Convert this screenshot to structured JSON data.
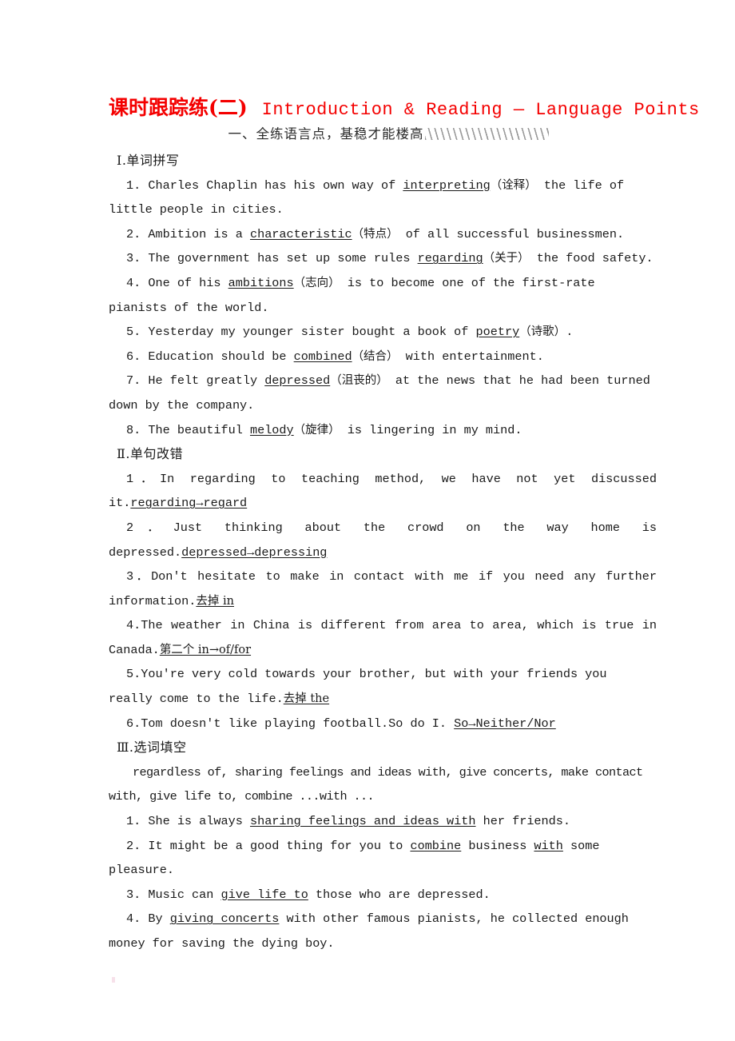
{
  "document": {
    "title_cn": "课时跟踪练(二)",
    "title_en": "Introduction & Reading — Language Points",
    "title_color": "#f40000",
    "banner": "一、全练语言点，基稳才能楼高"
  },
  "section_1": {
    "heading": "Ⅰ.单词拼写",
    "items": [
      {
        "num": "1.",
        "pre": "Charles Chaplin has his own way of ",
        "answer": "interpreting",
        "gloss": "（诠释）",
        "post": " the life of little people in cities."
      },
      {
        "num": "2.",
        "pre": "Ambition is a ",
        "answer": "characteristic",
        "gloss": "（特点）",
        "post": " of all successful businessmen."
      },
      {
        "num": "3.",
        "pre": "The government has set up some rules ",
        "answer": "regarding",
        "gloss": "（关于）",
        "post": "  the food safety."
      },
      {
        "num": "4.",
        "pre": "One of his ",
        "answer": "ambitions",
        "gloss": "（志向）",
        "post": "  is to become one of the first-rate pianists of the world."
      },
      {
        "num": "5.",
        "pre": "Yesterday my younger sister bought a book of ",
        "answer": "poetry",
        "gloss": "（诗歌）",
        "post": "."
      },
      {
        "num": "6.",
        "pre": "Education should be ",
        "answer": "combined",
        "gloss": "（结合）",
        "post": " with entertainment."
      },
      {
        "num": "7.",
        "pre": "He felt greatly ",
        "answer": "depressed",
        "gloss": "（沮丧的）",
        "post": " at the news that he had been turned down by the company."
      },
      {
        "num": "8.",
        "pre": "The beautiful ",
        "answer": "melody",
        "gloss": "（旋律）",
        "post": " is lingering in my mind."
      }
    ]
  },
  "section_2": {
    "heading": "Ⅱ.单句改错",
    "items": [
      {
        "num": "1．",
        "sentence": "In regarding to teaching method, we have not yet discussed it.",
        "correction": "regarding→regard",
        "correction_cn": ""
      },
      {
        "num": "2．",
        "sentence": "Just thinking about the crowd on the way home is depressed.",
        "correction": "depressed→depressing",
        "correction_cn": ""
      },
      {
        "num": "3．",
        "sentence": "Don't hesitate to make in contact with me if you need any further information.",
        "correction": "",
        "correction_cn": "去掉 in"
      },
      {
        "num": "4.",
        "sentence": "The weather in China is different from area to area, which is true in Canada.",
        "correction": "",
        "correction_cn": "第二个 in→of/for"
      },
      {
        "num": "5.",
        "sentence": "You're very cold towards your brother, but with your friends you really come to the life.",
        "correction": "",
        "correction_cn": "去掉 the"
      },
      {
        "num": "6.",
        "sentence": "Tom doesn't like playing football.So do I.",
        "correction": "So→Neither/Nor",
        "correction_cn": ""
      }
    ]
  },
  "section_3": {
    "heading": "Ⅲ.选词填空",
    "word_bank": "regardless of, sharing feelings and ideas with, give concerts, make contact with, give life to, combine ...with ...",
    "items": [
      {
        "num": "1.",
        "pre": "She is always ",
        "answer": "sharing feelings and ideas with",
        "post": " her friends."
      },
      {
        "num": "2.",
        "pre": "It might be a good thing for you to ",
        "answer": "combine",
        "mid": " business ",
        "answer2": "with",
        "post": " some pleasure."
      },
      {
        "num": "3.",
        "pre": "Music can ",
        "answer": "give life to",
        "post": " those who are depressed."
      },
      {
        "num": "4.",
        "pre": "By ",
        "answer": "giving concerts",
        "post": " with other famous pianists, he collected enough money for saving the dying boy."
      }
    ]
  }
}
